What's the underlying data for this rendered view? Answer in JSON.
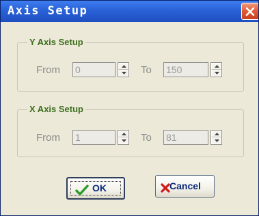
{
  "window": {
    "title": "Axis Setup"
  },
  "y_axis": {
    "group_label": "Y Axis Setup",
    "from_label": "From",
    "from_value": "0",
    "to_label": "To",
    "to_value": "150"
  },
  "x_axis": {
    "group_label": "X Axis Setup",
    "from_label": "From",
    "from_value": "1",
    "to_label": "To",
    "to_value": "81"
  },
  "buttons": {
    "ok_label": "OK",
    "cancel_label": "Cancel"
  },
  "colors": {
    "titlebar": "#2a62d8",
    "group_label": "#3c6e1d",
    "button_text": "#0a2a7a"
  },
  "icons": {
    "close": "close-icon",
    "ok": "checkmark-icon",
    "cancel": "x-mark-icon",
    "spin_up": "chevron-up-icon",
    "spin_down": "chevron-down-icon"
  }
}
